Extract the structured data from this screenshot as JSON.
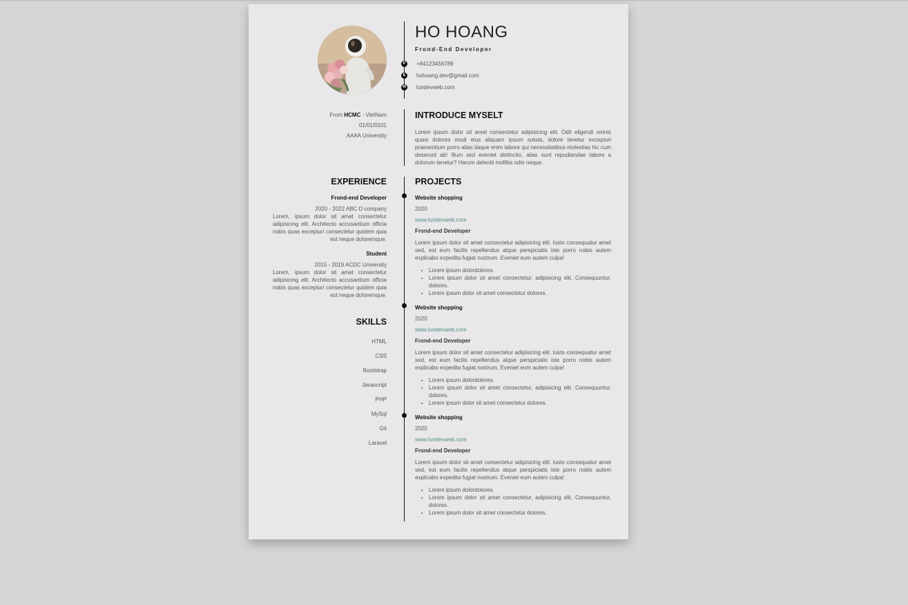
{
  "header": {
    "name": "HO HOANG",
    "job": "Frond-End Developer",
    "contacts": [
      {
        "letter": "P",
        "value": "+84123456789"
      },
      {
        "letter": "E",
        "value": "hohoang.dev@gmail.com"
      },
      {
        "letter": "W",
        "value": "lundevweb.com"
      }
    ]
  },
  "info": {
    "from_prefix": "From",
    "city": "HCMC",
    "country": "- VietNam",
    "birthday": "01/01/0101",
    "school": "AAAA University"
  },
  "intro": {
    "title": "INTRODUCE MYSELT",
    "text": "Lorem ipsum dolor sit amet consectetur adipisicing elit. Odit eligendi omnis quasi dolores modi eius aliquam ipsum soluta, dolore tenetur excepturi praesentium porro alias itaque enim labore qui necessitatibus molestias hic cum deserunt ab! Illum sed eveniet distinctio, alias sunt repudiandae labore a dolorum tenetur? Harum deleniti mollitia odio neque."
  },
  "experience": {
    "title": "EXPERIENCE",
    "items": [
      {
        "title": "Frond-end Developer",
        "date": "2020 - 2022 ABC D company",
        "desc": "Lorem, ipsum dolor sit amet consectetur adipisicing elit. Architecto accusantium officia nobis quas excepturi consectetur quidem quia est neque doloremque."
      },
      {
        "title": "Student",
        "date": "2015 - 2019 ACDC University",
        "desc": "Lorem, ipsum dolor sit amet consectetur adipisicing elit. Architecto accusantium officia nobis quas excepturi consectetur quidem quia est neque doloremque."
      }
    ]
  },
  "skills": {
    "title": "SKILLS",
    "items": [
      "HTML",
      "CSS",
      "Bootstrap",
      "Javascript",
      "PHP",
      "MySql",
      "Git",
      "Laravel"
    ]
  },
  "projects": {
    "title": "PROJECTS",
    "items": [
      {
        "name": "Website shopping",
        "year": "2020",
        "link": "www.lundevweb.com",
        "role": "Frond-end Developer",
        "desc": "Lorem ipsum dolor sit amet consectetur adipisicing elit. Iusto consequatur amet sed, est eum facilis repellendus atque perspiciatis iste porro nobis autem explicabo expedita fugiat nostrum. Eveniet eum autem culpa!",
        "bullets": [
          "Lorem ipsum dolordolores.",
          "Lorem ipsum dolor sit amet consectetur, adipisicing elit. Consequuntur, dolores.",
          "Lorem ipsum dolor sit amet consectetur dolores."
        ]
      },
      {
        "name": "Website shopping",
        "year": "2020",
        "link": "www.lundevweb.com",
        "role": "Frond-end Developer",
        "desc": "Lorem ipsum dolor sit amet consectetur adipisicing elit. Iusto consequatur amet sed, est eum facilis repellendus atque perspiciatis iste porro nobis autem explicabo expedita fugiat nostrum. Eveniet eum autem culpa!",
        "bullets": [
          "Lorem ipsum dolordolores.",
          "Lorem ipsum dolor sit amet consectetur, adipisicing elit. Consequuntur, dolores.",
          "Lorem ipsum dolor sit amet consectetur dolores."
        ]
      },
      {
        "name": "Website shopping",
        "year": "2020",
        "link": "www.lundevweb.com",
        "role": "Frond-end Developer",
        "desc": "Lorem ipsum dolor sit amet consectetur adipisicing elit. Iusto consequatur amet sed, est eum facilis repellendus atque perspiciatis iste porro nobis autem explicabo expedita fugiat nostrum. Eveniet eum autem culpa!",
        "bullets": [
          "Lorem ipsum dolordolores.",
          "Lorem ipsum dolor sit amet consectetur, adipisicing elit. Consequuntur, dolores.",
          "Lorem ipsum dolor sit amet consectetur dolores."
        ]
      }
    ]
  }
}
